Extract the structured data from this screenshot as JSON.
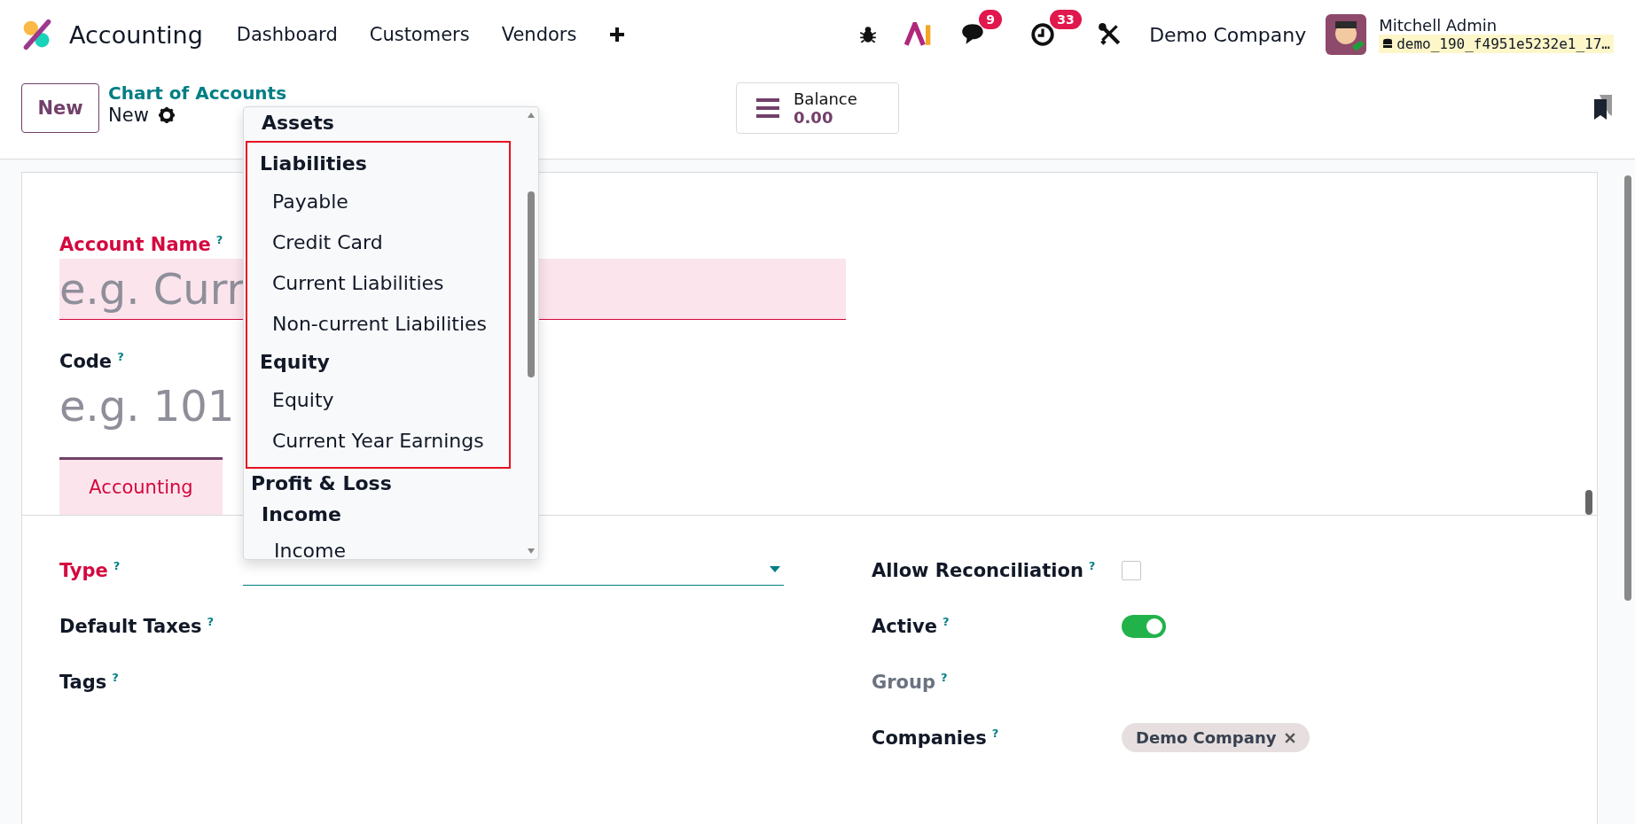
{
  "app": {
    "name": "Accounting"
  },
  "menu": [
    {
      "label": "Dashboard"
    },
    {
      "label": "Customers"
    },
    {
      "label": "Vendors"
    }
  ],
  "systray": {
    "messages_count": "9",
    "activities_count": "33",
    "company": "Demo Company",
    "user": "Mitchell Admin",
    "database": "demo_190_f4951e5232e1_17…"
  },
  "control": {
    "new_button": "New",
    "breadcrumb": "Chart of Accounts",
    "record": "New"
  },
  "balance": {
    "label": "Balance",
    "value": "0.00"
  },
  "form": {
    "account_name": {
      "label": "Account Name",
      "help": "?",
      "placeholder": "e.g. Curr",
      "required": true
    },
    "code": {
      "label": "Code",
      "help": "?",
      "placeholder": "e.g. 101",
      "required": false
    },
    "tabs": [
      {
        "label": "Accounting",
        "selected": true
      }
    ],
    "left_fields": [
      {
        "label": "Type",
        "help": "?",
        "required": true,
        "readonly": false,
        "kind": "select"
      },
      {
        "label": "Default Taxes",
        "help": "?",
        "required": false,
        "readonly": false,
        "kind": "empty"
      },
      {
        "label": "Tags",
        "help": "?",
        "required": false,
        "readonly": false,
        "kind": "empty"
      }
    ],
    "right_fields": [
      {
        "label": "Allow Reconciliation",
        "help": "?",
        "required": false,
        "readonly": false,
        "kind": "checkbox",
        "checked": false
      },
      {
        "label": "Active",
        "help": "?",
        "required": false,
        "readonly": false,
        "kind": "toggle",
        "on": true
      },
      {
        "label": "Group",
        "help": "?",
        "required": false,
        "readonly": true,
        "kind": "empty"
      },
      {
        "label": "Companies",
        "help": "?",
        "required": false,
        "readonly": false,
        "kind": "tags",
        "tags": [
          "Demo Company"
        ]
      }
    ]
  },
  "dropdown": {
    "items": [
      {
        "label": "Assets",
        "kind": "group",
        "highlighted": false
      },
      {
        "label": "Liabilities",
        "kind": "group",
        "highlighted": true,
        "children": [
          {
            "label": "Payable"
          },
          {
            "label": "Credit Card"
          },
          {
            "label": "Current Liabilities"
          },
          {
            "label": "Non-current Liabilities"
          }
        ]
      },
      {
        "label": "Equity",
        "kind": "group",
        "highlighted": true,
        "children": [
          {
            "label": "Equity"
          },
          {
            "label": "Current Year Earnings"
          }
        ]
      },
      {
        "label": "Profit & Loss",
        "kind": "section",
        "highlighted": false,
        "children": [
          {
            "label": "Income",
            "children": [
              {
                "label": "Income"
              }
            ]
          }
        ]
      }
    ]
  }
}
